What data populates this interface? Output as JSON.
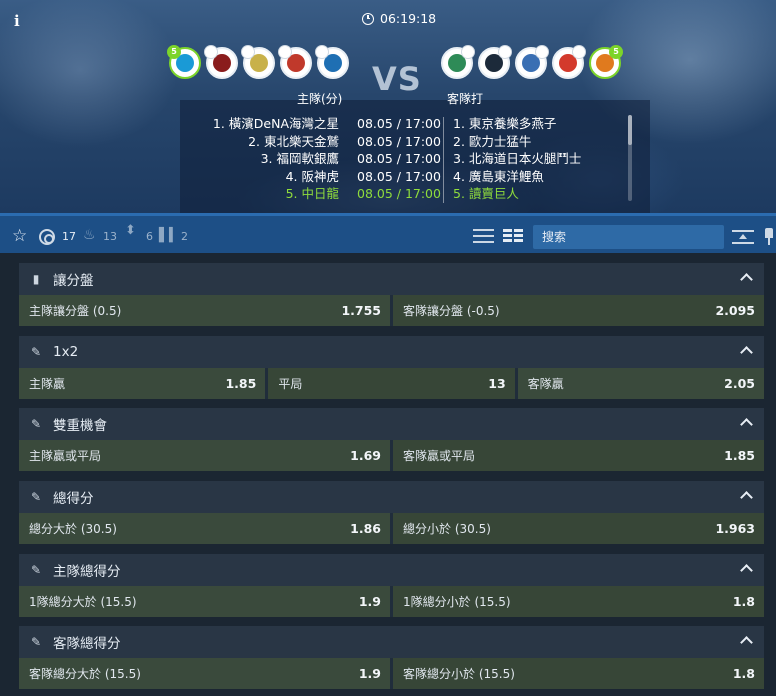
{
  "header": {
    "time": "06:19:18",
    "vs": "VS",
    "home_label": "主隊(分)",
    "away_label": "客隊打",
    "home_logos": [
      {
        "name": "dena-logo",
        "color": "#1a9ad6",
        "badge": "5",
        "highlight": true
      },
      {
        "name": "eagles-logo",
        "color": "#8a1c1c",
        "badge": "",
        "highlight": false
      },
      {
        "name": "hawks-logo",
        "color": "#c8b14a",
        "badge": "",
        "highlight": false
      },
      {
        "name": "tigers-logo",
        "color": "#c0392b",
        "badge": "",
        "highlight": false
      },
      {
        "name": "dragons-logo",
        "color": "#1f6fb3",
        "badge": "",
        "highlight": false
      }
    ],
    "away_logos": [
      {
        "name": "swallows-logo",
        "color": "#2e8b57",
        "badge": "",
        "highlight": false
      },
      {
        "name": "buffaloes-logo",
        "color": "#1c2a3a",
        "badge": "",
        "highlight": false
      },
      {
        "name": "fighters-logo",
        "color": "#3a6fb3",
        "badge": "",
        "highlight": false
      },
      {
        "name": "carp-logo",
        "color": "#d33a2c",
        "badge": "",
        "highlight": false
      },
      {
        "name": "giants-logo",
        "color": "#e07a1e",
        "badge": "5",
        "highlight": true
      }
    ],
    "home_teams": [
      "1. 橫濱DeNA海灣之星",
      "2. 東北樂天金鷲",
      "3. 福岡軟銀鷹",
      "4. 阪神虎",
      "5. 中日龍"
    ],
    "times": [
      "08.05 / 17:00",
      "08.05 / 17:00",
      "08.05 / 17:00",
      "08.05 / 17:00",
      "08.05 / 17:00"
    ],
    "away_teams": [
      "1. 東京養樂多燕子",
      "2. 歐力士猛牛",
      "3. 北海道日本火腿鬥士",
      "4. 廣島東洋鯉魚",
      "5. 讀賣巨人"
    ]
  },
  "toolbar": {
    "count_all": "17",
    "count_fire": "13",
    "count_move": "6",
    "count_stat": "2",
    "search_placeholder": "搜索"
  },
  "markets": [
    {
      "title": "讓分盤",
      "odds": [
        [
          "主隊讓分盤 (0.5)",
          "1.755"
        ],
        [
          "客隊讓分盤 (-0.5)",
          "2.095"
        ]
      ]
    },
    {
      "title": "1x2",
      "odds": [
        [
          "主隊贏",
          "1.85"
        ],
        [
          "平局",
          "13"
        ],
        [
          "客隊贏",
          "2.05"
        ]
      ]
    },
    {
      "title": "雙重機會",
      "odds": [
        [
          "主隊贏或平局",
          "1.69"
        ],
        [
          "客隊贏或平局",
          "1.85"
        ]
      ]
    },
    {
      "title": "總得分",
      "odds": [
        [
          "總分大於 (30.5)",
          "1.86"
        ],
        [
          "總分小於 (30.5)",
          "1.963"
        ]
      ]
    },
    {
      "title": "主隊總得分",
      "odds": [
        [
          "1隊總分大於 (15.5)",
          "1.9"
        ],
        [
          "1隊總分小於 (15.5)",
          "1.8"
        ]
      ]
    },
    {
      "title": "客隊總得分",
      "odds": [
        [
          "客隊總分大於 (15.5)",
          "1.9"
        ],
        [
          "客隊總分小於 (15.5)",
          "1.8"
        ]
      ]
    }
  ]
}
